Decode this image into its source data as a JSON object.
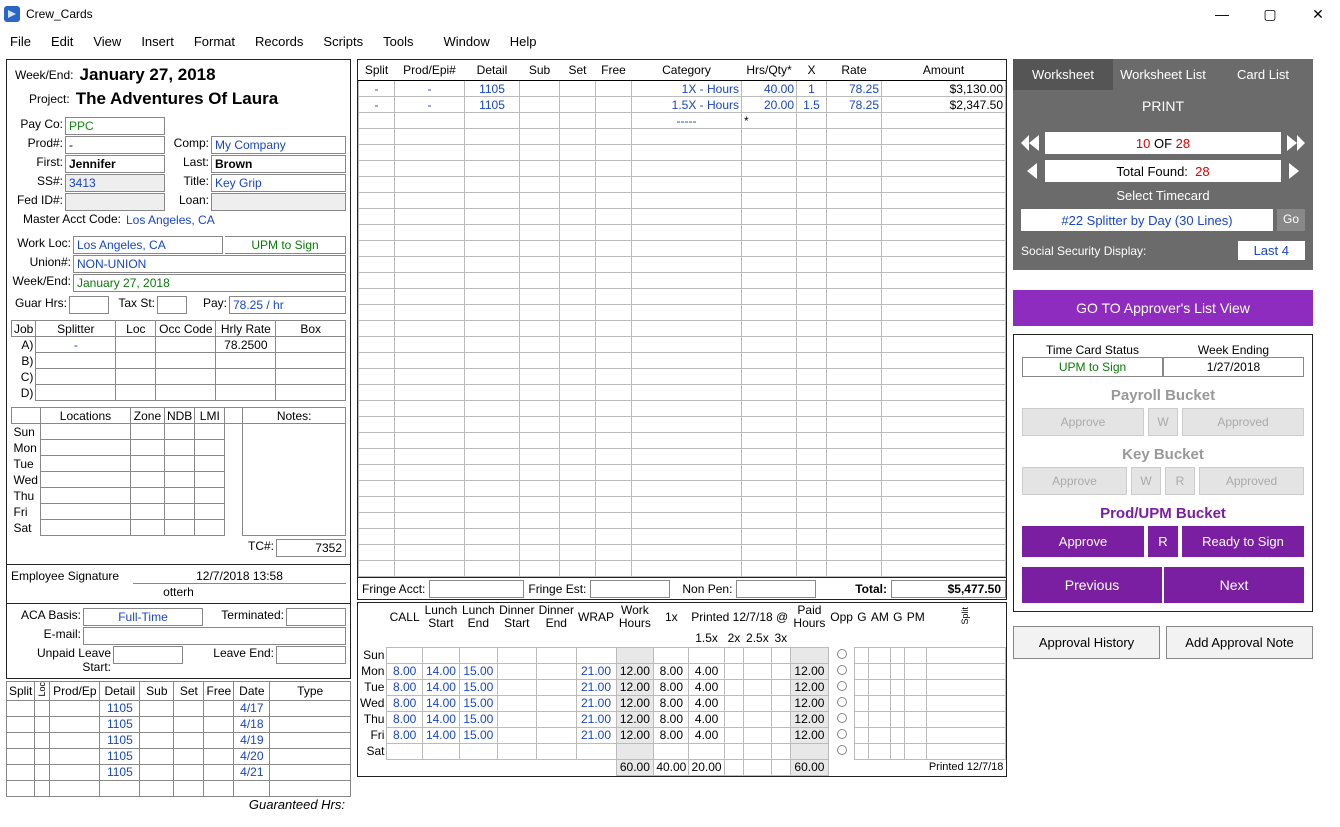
{
  "window": {
    "title": "Crew_Cards"
  },
  "menu": [
    "File",
    "Edit",
    "View",
    "Insert",
    "Format",
    "Records",
    "Scripts",
    "Tools",
    "Window",
    "Help"
  ],
  "header": {
    "weekend_label": "Week/End:",
    "weekend": "January 27, 2018",
    "project_label": "Project:",
    "project": "The Adventures Of Laura"
  },
  "emp": {
    "payco_label": "Pay Co:",
    "payco": "PPC",
    "prodnum_label": "Prod#:",
    "prodnum": "-",
    "comp_label": "Comp:",
    "comp": "My Company",
    "first_label": "First:",
    "first": "Jennifer",
    "last_label": "Last:",
    "last": "Brown",
    "ss_label": "SS#:",
    "ss": "3413",
    "title_label": "Title:",
    "title": "Key Grip",
    "fedid_label": "Fed ID#:",
    "loan_label": "Loan:",
    "mac_label": "Master Acct Code:",
    "mac": "Los Angeles, CA",
    "workloc_label": "Work Loc:",
    "workloc": "Los Angeles, CA",
    "upm_to_sign": "UPM to Sign",
    "union_label": "Union#:",
    "union": "NON-UNION",
    "weekend2_label": "Week/End:",
    "weekend2": "January 27, 2018",
    "guarhrs_label": "Guar Hrs:",
    "taxst_label": "Tax St:",
    "pay_label": "Pay:",
    "pay": "78.25 / hr"
  },
  "job_table": {
    "headers": [
      "Job",
      "Splitter",
      "Loc",
      "Occ Code",
      "Hrly Rate",
      "Box"
    ],
    "rows": [
      "A)",
      "B)",
      "C)",
      "D)"
    ],
    "splitter_a": "-",
    "rate_a": "78.2500"
  },
  "loc_table": {
    "headers": [
      "",
      "Locations",
      "Zone",
      "NDB",
      "LMI",
      "Notes:"
    ],
    "days": [
      "Sun",
      "Mon",
      "Tue",
      "Wed",
      "Thu",
      "Fri",
      "Sat"
    ],
    "tc_label": "TC#:",
    "tc": "7352"
  },
  "sig": {
    "label": "Employee Signature",
    "ts": "12/7/2018 13:58",
    "user": "otterh",
    "aca_label": "ACA Basis:",
    "aca": "Full-Time",
    "term_label": "Terminated:",
    "email_label": "E-mail:",
    "ul_start_label": "Unpaid Leave Start:",
    "ul_end_label": "Leave End:"
  },
  "main_grid": {
    "headers": [
      "Split",
      "Prod/Epi#",
      "Detail",
      "Sub",
      "Set",
      "Free",
      "Category",
      "Hrs/Qty*",
      "X",
      "Rate",
      "Amount"
    ],
    "rows": [
      {
        "split": "-",
        "prod": "-",
        "detail": "1105",
        "cat": "1X - Hours",
        "hrs": "40.00",
        "x": "1",
        "rate": "78.25",
        "amt": "$3,130.00"
      },
      {
        "split": "-",
        "prod": "-",
        "detail": "1105",
        "cat": "1.5X - Hours",
        "hrs": "20.00",
        "x": "1.5",
        "rate": "78.25",
        "amt": "$2,347.50"
      }
    ],
    "dash_row": {
      "cat": "-----",
      "hrs": "*"
    },
    "fringe_acct_label": "Fringe Acct:",
    "fringe_est_label": "Fringe Est:",
    "nonpen_label": "Non Pen:",
    "total_label": "Total:",
    "total": "$5,477.50"
  },
  "lower_left": {
    "headers": [
      "Split",
      "Loc",
      "Prod/Ep",
      "Detail",
      "Sub",
      "Set",
      "Free",
      "Date",
      "Type"
    ],
    "rows": [
      {
        "detail": "1105",
        "date": "4/17"
      },
      {
        "detail": "1105",
        "date": "4/18"
      },
      {
        "detail": "1105",
        "date": "4/19"
      },
      {
        "detail": "1105",
        "date": "4/20"
      },
      {
        "detail": "1105",
        "date": "4/21"
      }
    ]
  },
  "hours": {
    "headers": [
      "",
      "CALL",
      "Lunch\nStart",
      "Lunch\nEnd",
      "Dinner\nStart",
      "Dinner\nEnd",
      "WRAP",
      "Work\nHours",
      "1x",
      "1.5x",
      "2x",
      "2.5x",
      "3x",
      "Paid\nHours",
      "Opp",
      "G",
      "AM",
      "G",
      "PM",
      "Split"
    ],
    "printed_label": "Printed 12/7/18 @",
    "days": [
      "Sun",
      "Mon",
      "Tue",
      "Wed",
      "Thu",
      "Fri",
      "Sat"
    ],
    "rows": [
      {},
      {
        "call": "8.00",
        "ls": "14.00",
        "le": "15.00",
        "wrap": "21.00",
        "wh": "12.00",
        "x1": "8.00",
        "x15": "4.00",
        "ph": "12.00"
      },
      {
        "call": "8.00",
        "ls": "14.00",
        "le": "15.00",
        "wrap": "21.00",
        "wh": "12.00",
        "x1": "8.00",
        "x15": "4.00",
        "ph": "12.00"
      },
      {
        "call": "8.00",
        "ls": "14.00",
        "le": "15.00",
        "wrap": "21.00",
        "wh": "12.00",
        "x1": "8.00",
        "x15": "4.00",
        "ph": "12.00"
      },
      {
        "call": "8.00",
        "ls": "14.00",
        "le": "15.00",
        "wrap": "21.00",
        "wh": "12.00",
        "x1": "8.00",
        "x15": "4.00",
        "ph": "12.00"
      },
      {
        "call": "8.00",
        "ls": "14.00",
        "le": "15.00",
        "wrap": "21.00",
        "wh": "12.00",
        "x1": "8.00",
        "x15": "4.00",
        "ph": "12.00"
      },
      {}
    ],
    "guar_label": "Guaranteed Hrs:",
    "tot_wh": "60.00",
    "tot_1x": "40.00",
    "tot_15": "20.00",
    "tot_ph": "60.00",
    "printed_footer": "Printed 12/7/18"
  },
  "right": {
    "tabs": [
      "Worksheet",
      "Worksheet List",
      "Card List"
    ],
    "print": "PRINT",
    "nav": {
      "cur": "10",
      "of": "OF",
      "tot": "28",
      "found_label": "Total Found:",
      "found": "28"
    },
    "select_label": "Select Timecard",
    "select_value": "#22 Splitter by Day (30 Lines)",
    "go": "Go",
    "ssd_label": "Social Security Display:",
    "ssd": "Last 4",
    "goto": "GO TO Approver's List View",
    "tcs_label": "Time Card Status",
    "we_label": "Week Ending",
    "tcs_val": "UPM to Sign",
    "we_val": "1/27/2018",
    "bucket1": "Payroll Bucket",
    "bucket2": "Key Bucket",
    "bucket3": "Prod/UPM Bucket",
    "approve": "Approve",
    "w": "W",
    "r": "R",
    "approved": "Approved",
    "ready": "Ready to Sign",
    "prev": "Previous",
    "next": "Next",
    "hist": "Approval History",
    "addnote": "Add Approval Note"
  }
}
